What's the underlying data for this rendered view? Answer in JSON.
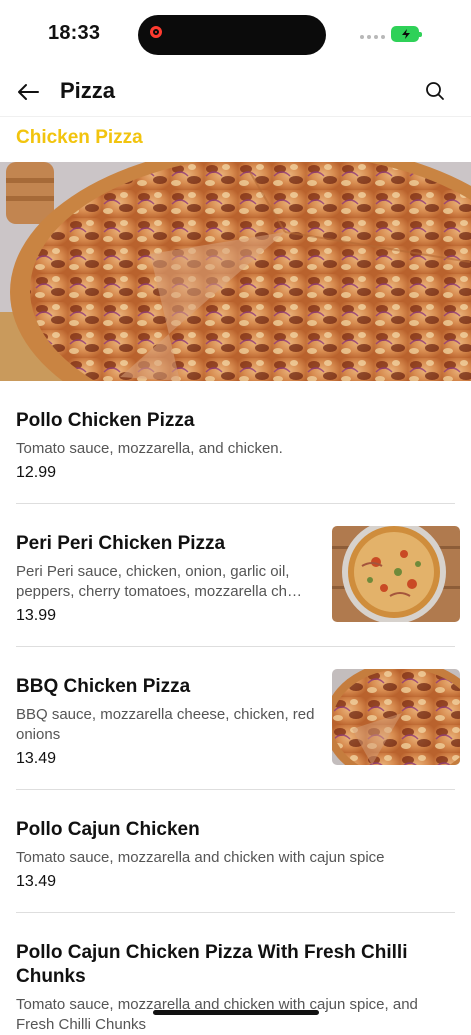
{
  "status": {
    "time": "18:33"
  },
  "header": {
    "title": "Pizza",
    "back_icon": "arrow-left-icon",
    "search_icon": "search-icon"
  },
  "category": {
    "title": "Chicken Pizza",
    "accent": "#f2c40e"
  },
  "items": [
    {
      "name": "Pollo Chicken Pizza",
      "description": "Tomato sauce, mozzarella, and chicken.",
      "price": "12.99"
    },
    {
      "name": "Peri Peri Chicken Pizza",
      "description": "Peri Peri sauce, chicken, onion, garlic oil, peppers, cherry tomatoes, mozzarella ch…",
      "price": "13.99"
    },
    {
      "name": "BBQ Chicken Pizza",
      "description": "BBQ sauce, mozzarella cheese, chicken, red onions",
      "price": "13.49"
    },
    {
      "name": "Pollo Cajun Chicken",
      "description": "Tomato sauce, mozzarella and chicken with cajun spice",
      "price": "13.49"
    },
    {
      "name": "Pollo Cajun Chicken Pizza With Fresh Chilli Chunks",
      "description": "Tomato sauce, mozzarella and chicken with cajun spice, and Fresh Chilli Chunks"
    }
  ]
}
